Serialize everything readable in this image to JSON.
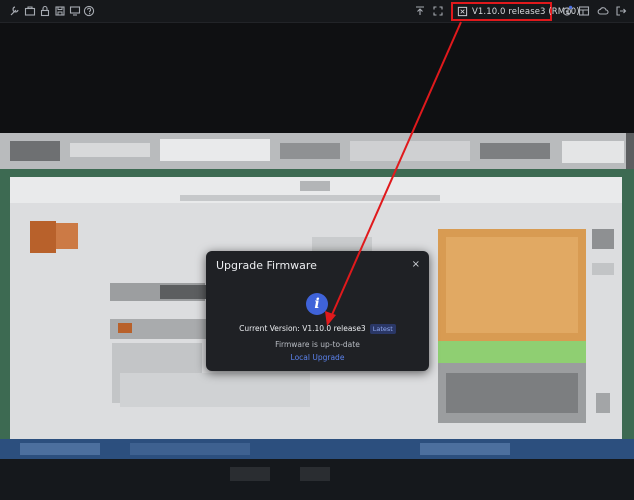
{
  "topbar": {
    "left_icons": [
      "tools-icon",
      "briefcase-icon",
      "lock-icon",
      "save-icon",
      "monitor-icon",
      "help-icon"
    ],
    "right_icons": [
      "upload-icon",
      "fullscreen-icon",
      "notification-icon",
      "table-icon",
      "cloud-icon",
      "logout-icon"
    ],
    "version_label": "V1.10.0 release3 (RM10)"
  },
  "dialog": {
    "title": "Upgrade Firmware",
    "close": "×",
    "info_glyph": "i",
    "current_version_label": "Current Version: V1.10.0 release3",
    "latest_badge": "Latest",
    "status": "Firmware is up-to-date",
    "local_upgrade_link": "Local Upgrade"
  },
  "colors": {
    "annotation_red": "#e0191c",
    "accent_blue": "#3f63d9",
    "link_blue": "#5b82ec"
  }
}
